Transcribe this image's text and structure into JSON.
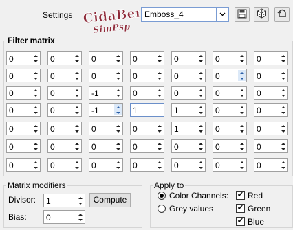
{
  "header": {
    "settings_label": "Settings",
    "logo_line1": "CidaBen",
    "logo_line2": "SimPsp",
    "preset_value": "Emboss_4"
  },
  "toolbar": {
    "icons": [
      "save-icon",
      "randomize-dice-icon",
      "reset-icon"
    ]
  },
  "filter_matrix": {
    "title": "Filter matrix",
    "rows": [
      [
        "0",
        "0",
        "0",
        "0",
        "0",
        "0",
        "0"
      ],
      [
        "0",
        "0",
        "0",
        "0",
        "0",
        "0",
        "0"
      ],
      [
        "0",
        "0",
        "-1",
        "0",
        "0",
        "0",
        "0"
      ],
      [
        "0",
        "0",
        "-1",
        "1",
        "1",
        "0",
        "0"
      ],
      [
        "0",
        "0",
        "0",
        "0",
        "1",
        "0",
        "0"
      ],
      [
        "0",
        "0",
        "0",
        "0",
        "0",
        "0",
        "0"
      ],
      [
        "0",
        "0",
        "0",
        "0",
        "0",
        "0",
        "0"
      ]
    ]
  },
  "matrix_modifiers": {
    "title": "Matrix modifiers",
    "divisor_label": "Divisor:",
    "divisor_value": "1",
    "bias_label": "Bias:",
    "bias_value": "0",
    "compute_label": "Compute"
  },
  "apply_to": {
    "title": "Apply to",
    "color_channels_label": "Color Channels:",
    "grey_values_label": "Grey values",
    "selected": "color_channels",
    "red_label": "Red",
    "green_label": "Green",
    "blue_label": "Blue",
    "red_checked": true,
    "green_checked": true,
    "blue_checked": true
  }
}
